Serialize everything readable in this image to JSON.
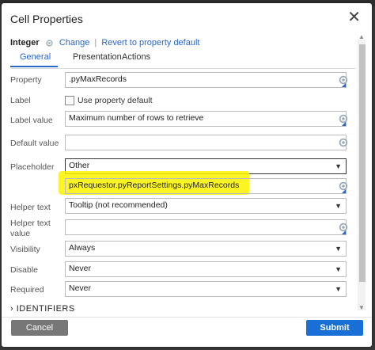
{
  "dialog": {
    "title": "Cell Properties",
    "close_icon": "close-icon"
  },
  "header": {
    "type": "Integer",
    "change_label": "Change",
    "revert_label": "Revert to property default",
    "separator": "|"
  },
  "tabs": [
    {
      "label": "General",
      "active": true
    },
    {
      "label": "Presentation",
      "active": false
    },
    {
      "label": "Actions",
      "active": false
    }
  ],
  "form": {
    "property": {
      "label": "Property",
      "value": ".pyMaxRecords"
    },
    "label": {
      "label": "Label",
      "checkbox_label": "Use property default",
      "checked": false
    },
    "label_value": {
      "label": "Label value",
      "value": "Maximum number of rows to retrieve"
    },
    "default_value": {
      "label": "Default value",
      "value": ""
    },
    "placeholder": {
      "label": "Placeholder",
      "value": "Other",
      "custom_value": "pxRequestor.pyReportSettings.pyMaxRecords"
    },
    "helper_text": {
      "label": "Helper text",
      "value": "Tooltip (not recommended)"
    },
    "helper_text_value": {
      "label_line1": "Helper text",
      "label_line2": "value",
      "value": ""
    },
    "visibility": {
      "label": "Visibility",
      "value": "Always"
    },
    "disable": {
      "label": "Disable",
      "value": "Never"
    },
    "required": {
      "label": "Required",
      "value": "Never"
    },
    "identifiers_section": "IDENTIFIERS"
  },
  "footer": {
    "cancel_label": "Cancel",
    "submit_label": "Submit"
  },
  "colors": {
    "link": "#2b66c4",
    "submit": "#1a6fd6",
    "cancel": "#777777",
    "highlight": "#fdf200"
  }
}
